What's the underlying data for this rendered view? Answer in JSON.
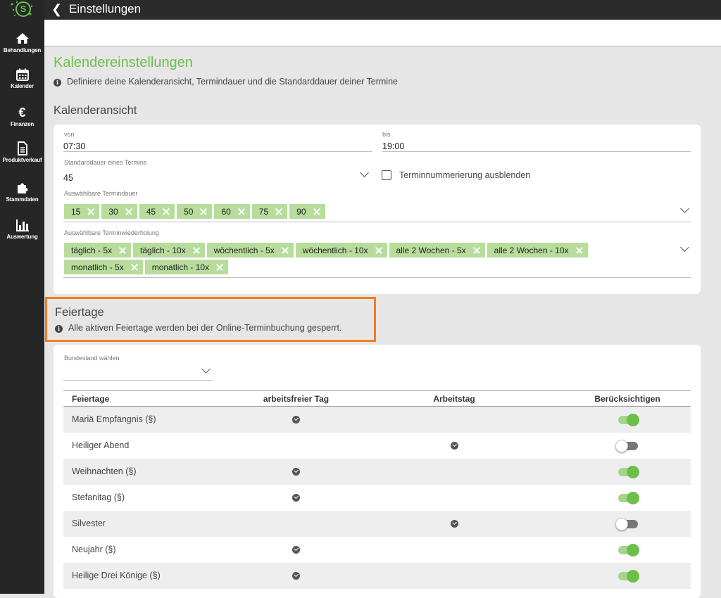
{
  "app": {
    "logo_letter": "S"
  },
  "sidebar": {
    "items": [
      {
        "label": "Behandlungen",
        "icon": "home-icon"
      },
      {
        "label": "Kalender",
        "icon": "calendar-icon"
      },
      {
        "label": "Finanzen",
        "icon": "euro-icon"
      },
      {
        "label": "Produktverkauf",
        "icon": "document-icon"
      },
      {
        "label": "Stammdaten",
        "icon": "puzzle-icon"
      },
      {
        "label": "Auswertung",
        "icon": "bar-chart-icon"
      }
    ]
  },
  "header": {
    "back_glyph": "❮",
    "title": "Einstellungen"
  },
  "calendar_settings": {
    "title": "Kalendereinstellungen",
    "info": "Definiere deine Kalenderansicht, Termindauer und die Standarddauer deiner Termine",
    "view_title": "Kalenderansicht",
    "from_label": "von",
    "from_value": "07:30",
    "to_label": "bis",
    "to_value": "19:00",
    "default_duration_label": "Standarddauer eines Termins",
    "default_duration_value": "45",
    "hide_numbering_label": "Terminnummerierung ausblenden",
    "hide_numbering_checked": false,
    "durations_label": "Auswählbare Termindauer",
    "durations": [
      "15",
      "30",
      "45",
      "50",
      "60",
      "75",
      "90"
    ],
    "repeats_label": "Auswählbare Terminwiederholung",
    "repeats": [
      "täglich - 5x",
      "täglich - 10x",
      "wöchentlich - 5x",
      "wöchentlich - 10x",
      "alle 2 Wochen - 5x",
      "alle 2 Wochen - 10x",
      "monatlich - 5x",
      "monatlich - 10x"
    ]
  },
  "holidays": {
    "title": "Feiertage",
    "info": "Alle aktiven Feiertage werden bei der Online-Terminbuchung gesperrt.",
    "state_label": "Bundesland wählen",
    "state_value": "",
    "columns": [
      "Feiertage",
      "arbeitsfreier Tag",
      "Arbeitstag",
      "Berücksichtigen"
    ],
    "rows": [
      {
        "name": "Mariä Empfängnis (§)",
        "day_off": true,
        "working_day": false,
        "consider": true
      },
      {
        "name": "Heiliger Abend",
        "day_off": false,
        "working_day": true,
        "consider": false
      },
      {
        "name": "Weihnachten (§)",
        "day_off": true,
        "working_day": false,
        "consider": true
      },
      {
        "name": "Stefanitag (§)",
        "day_off": true,
        "working_day": false,
        "consider": true
      },
      {
        "name": "Silvester",
        "day_off": false,
        "working_day": true,
        "consider": false
      },
      {
        "name": "Neujahr (§)",
        "day_off": true,
        "working_day": false,
        "consider": true
      },
      {
        "name": "Heilige Drei Könige (§)",
        "day_off": true,
        "working_day": false,
        "consider": true
      }
    ]
  },
  "colors": {
    "accent": "#6cc04a",
    "highlight": "#f47e20",
    "chip": "#b7dc9c",
    "sidebar": "#262626"
  }
}
